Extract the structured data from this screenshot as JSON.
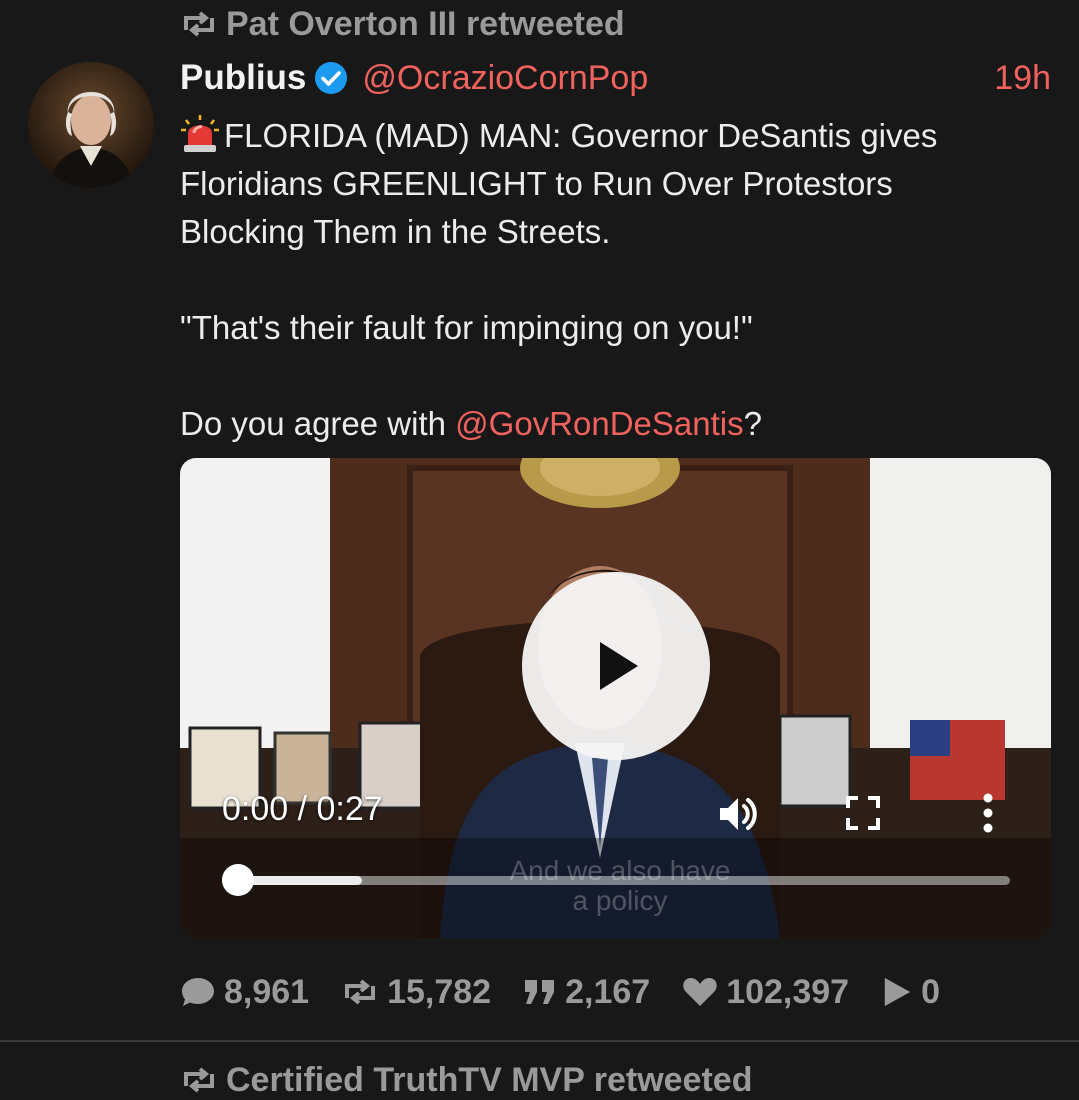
{
  "retweet_header": {
    "text": "Pat Overton III retweeted"
  },
  "post": {
    "author_name": "Publius",
    "handle": "@OcrazioCornPop",
    "time": "19h",
    "lines": [
      "FLORIDA (MAD) MAN:  Governor DeSantis gives",
      "Floridians GREENLIGHT to Run Over Protestors",
      "Blocking Them in the Streets."
    ],
    "quote": "\"That's their fault for impinging on you!\"",
    "question_prefix": "Do you agree with ",
    "question_mention": "@GovRonDeSantis",
    "question_suffix": "?"
  },
  "video": {
    "time": "0:00 / 0:27",
    "caption_line1": "And we also have",
    "caption_line2": "a policy",
    "progress_buffered": 0.16,
    "progress_played": 0.0
  },
  "stats": {
    "replies": "8,961",
    "retruths": "15,782",
    "quotes": "2,167",
    "likes": "102,397",
    "views": "0"
  },
  "next_retweet": {
    "text": "Certified TruthTV MVP retweeted"
  },
  "colors": {
    "accent": "#f0625e",
    "muted": "#9a9a9a",
    "background": "#181818",
    "verified": "#1d9bf0"
  },
  "icons": [
    "retweet-icon",
    "verified-badge-icon",
    "siren-icon",
    "play-icon",
    "volume-icon",
    "fullscreen-icon",
    "more-vert-icon",
    "comment-icon",
    "quote-icon",
    "heart-icon",
    "views-play-icon"
  ]
}
